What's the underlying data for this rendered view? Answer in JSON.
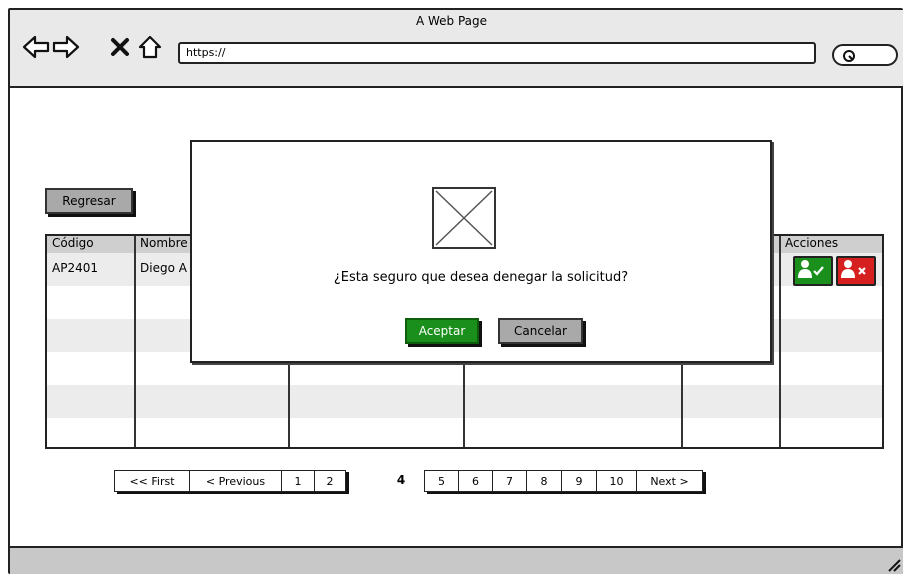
{
  "browser": {
    "title": "A Web Page",
    "url": "https://",
    "back_icon": "arrow-left-icon",
    "forward_icon": "arrow-right-icon",
    "close_icon": "close-icon",
    "home_icon": "home-icon",
    "search_icon": "search-icon"
  },
  "page": {
    "back_button": "Regresar",
    "table": {
      "columns": [
        "Código",
        "Nombre",
        "",
        "",
        "",
        "Acciones"
      ],
      "rows": [
        {
          "codigo": "AP2401",
          "nombre": "Diego A"
        }
      ],
      "actions": {
        "approve_icon": "user-check-icon",
        "deny_icon": "user-x-icon",
        "approve_color": "#1b8f1b",
        "deny_color": "#d62020"
      }
    },
    "pagination": {
      "first": "<< First",
      "previous": "< Previous",
      "pages_before": [
        "1",
        "2"
      ],
      "current": "4",
      "pages_after": [
        "5",
        "6",
        "7",
        "8",
        "9",
        "10"
      ],
      "next": "Next >"
    }
  },
  "modal": {
    "image_icon": "image-placeholder-icon",
    "message": "¿Esta seguro que desea denegar la solicitud?",
    "accept_label": "Aceptar",
    "cancel_label": "Cancelar",
    "accept_color": "#1b8f1b"
  }
}
